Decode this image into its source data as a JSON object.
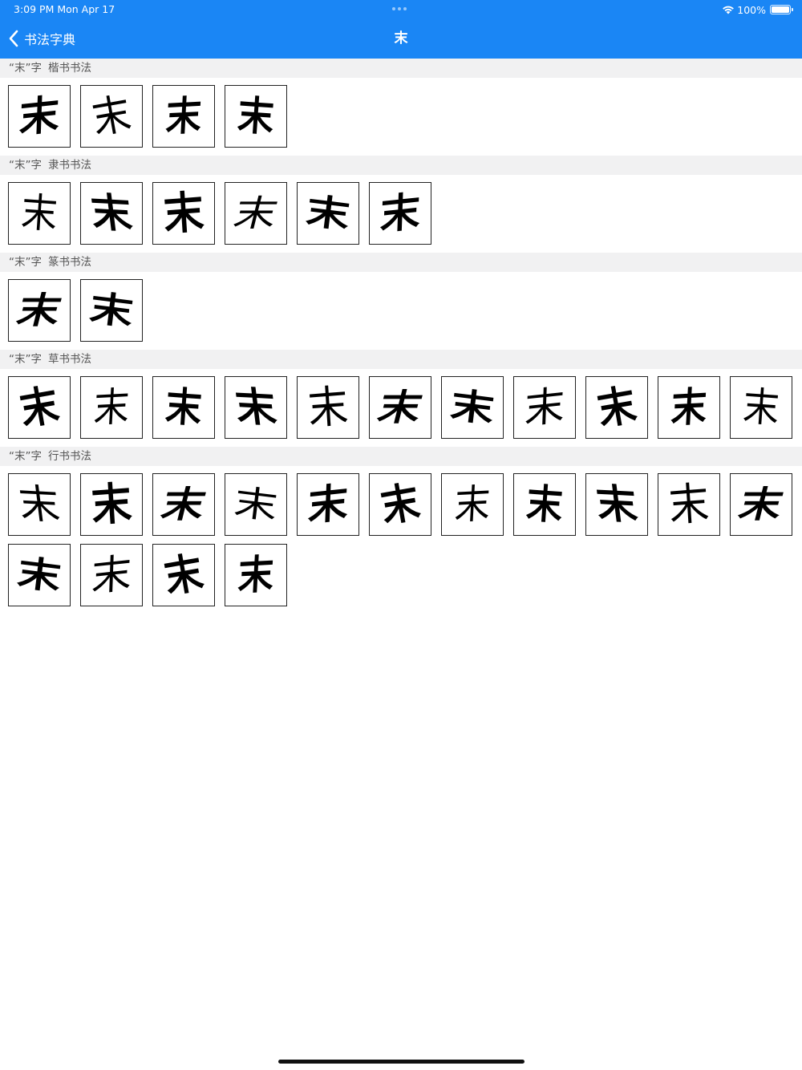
{
  "status_bar": {
    "time": "3:09 PM   Mon Apr 17",
    "battery": "100%"
  },
  "nav": {
    "back_label": "书法字典",
    "title": "末"
  },
  "sections": [
    {
      "label": "“末”字",
      "style": "楷书书法",
      "count": 4,
      "glyph": "末"
    },
    {
      "label": "“末”字",
      "style": "隶书书法",
      "count": 6,
      "glyph": "末"
    },
    {
      "label": "“末”字",
      "style": "篆书书法",
      "count": 2,
      "glyph": "末"
    },
    {
      "label": "“末”字",
      "style": "草书书法",
      "count": 11,
      "glyph": "末"
    },
    {
      "label": "“末”字",
      "style": "行书书法",
      "count": 15,
      "glyph": "末"
    }
  ]
}
